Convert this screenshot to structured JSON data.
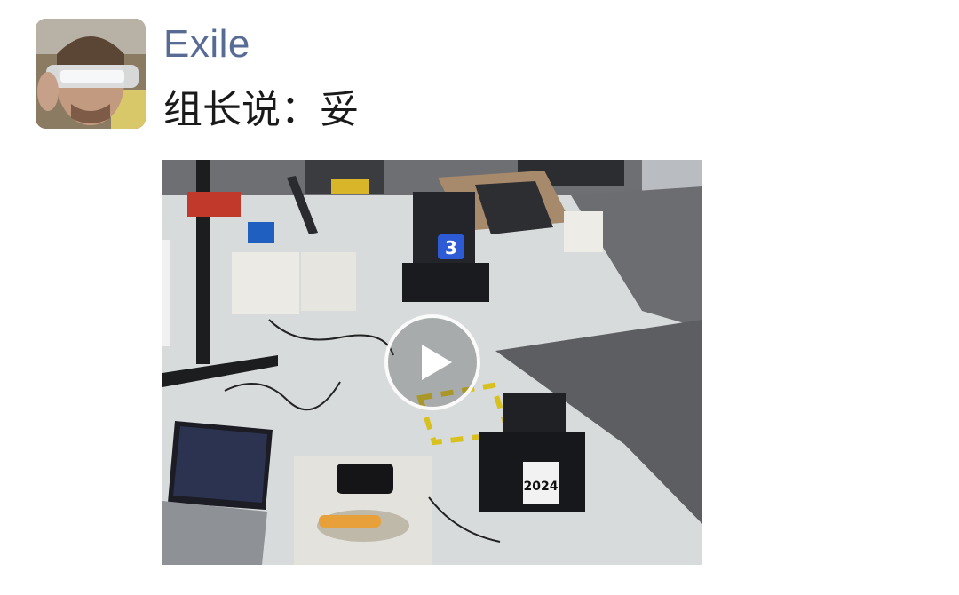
{
  "post": {
    "username": "Exile",
    "text": "组长说：妥"
  },
  "avatar": {
    "icon": "user-avatar-photo"
  },
  "video": {
    "icon": "play-icon",
    "robot_number": "3",
    "robot_label": "2024"
  },
  "colors": {
    "username": "#576b95",
    "text": "#1a1a1a",
    "background": "#ffffff"
  }
}
